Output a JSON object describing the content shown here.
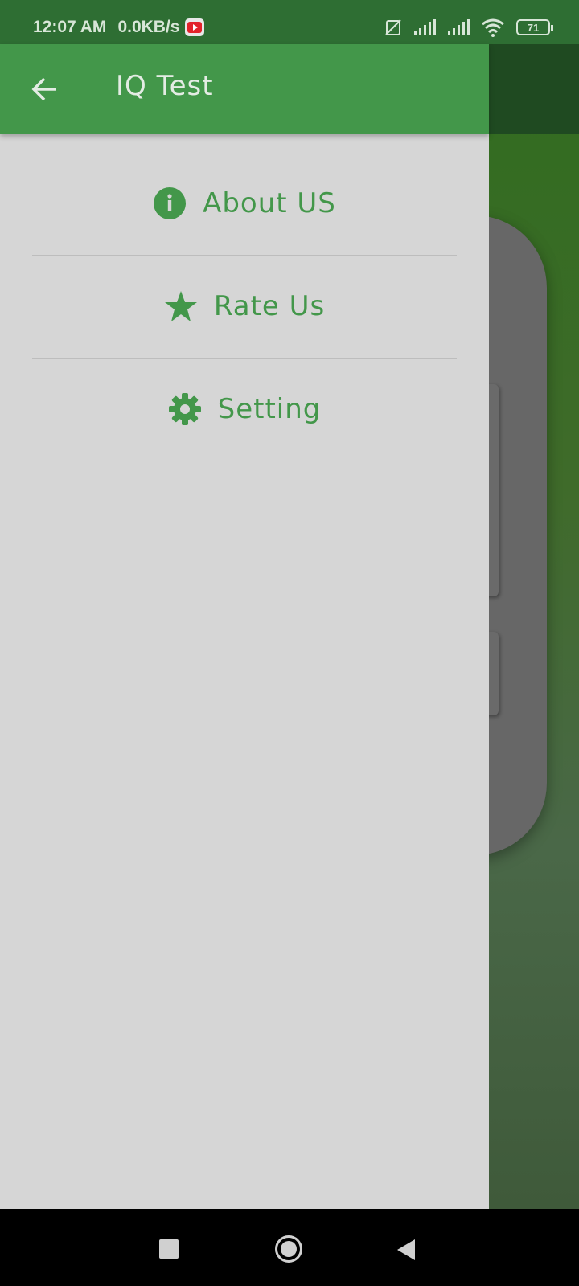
{
  "status_bar": {
    "time": "12:07 AM",
    "speed": "0.0KB/s",
    "battery": "71",
    "icons": [
      "youtube-notification-icon",
      "no-sim-icon",
      "signal-icon",
      "signal-icon",
      "wifi-icon",
      "battery-icon"
    ]
  },
  "drawer": {
    "title": "IQ Test",
    "back_icon": "arrow-back-icon",
    "items": [
      {
        "label": "About US",
        "icon": "info-icon"
      },
      {
        "label": "Rate Us",
        "icon": "star-icon"
      },
      {
        "label": "Setting",
        "icon": "gear-icon"
      }
    ]
  },
  "colors": {
    "accent": "#43974a",
    "status_bar": "#2e6e33",
    "drawer_bg": "#d6d6d6"
  },
  "nav_bar": {
    "buttons": [
      "recent-apps",
      "home",
      "back"
    ]
  }
}
